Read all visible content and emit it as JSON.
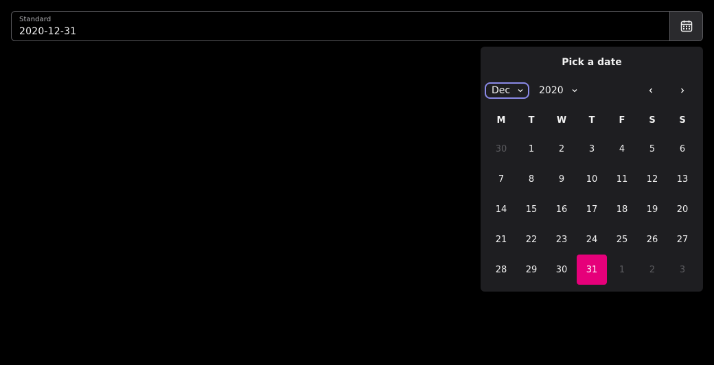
{
  "field": {
    "label": "Standard",
    "value": "2020-12-31",
    "button_icon": "calendar-icon"
  },
  "popup": {
    "title": "Pick a date",
    "month": "Dec",
    "year": "2020",
    "prev_icon": "chevron-left-icon",
    "next_icon": "chevron-right-icon"
  },
  "weekdays": [
    "M",
    "T",
    "W",
    "T",
    "F",
    "S",
    "S"
  ],
  "days": [
    {
      "label": "30",
      "outside": true
    },
    {
      "label": "1"
    },
    {
      "label": "2"
    },
    {
      "label": "3"
    },
    {
      "label": "4"
    },
    {
      "label": "5"
    },
    {
      "label": "6"
    },
    {
      "label": "7"
    },
    {
      "label": "8"
    },
    {
      "label": "9"
    },
    {
      "label": "10"
    },
    {
      "label": "11"
    },
    {
      "label": "12"
    },
    {
      "label": "13"
    },
    {
      "label": "14"
    },
    {
      "label": "15"
    },
    {
      "label": "16"
    },
    {
      "label": "17"
    },
    {
      "label": "18"
    },
    {
      "label": "19"
    },
    {
      "label": "20"
    },
    {
      "label": "21"
    },
    {
      "label": "22"
    },
    {
      "label": "23"
    },
    {
      "label": "24"
    },
    {
      "label": "25"
    },
    {
      "label": "26"
    },
    {
      "label": "27"
    },
    {
      "label": "28"
    },
    {
      "label": "29"
    },
    {
      "label": "30"
    },
    {
      "label": "31",
      "selected": true
    },
    {
      "label": "1",
      "outside": true
    },
    {
      "label": "2",
      "outside": true
    },
    {
      "label": "3",
      "outside": true
    }
  ],
  "colors": {
    "selected": "#e6007a",
    "focus_ring": "#8b8ae8",
    "popup_bg": "#1e1e21"
  }
}
